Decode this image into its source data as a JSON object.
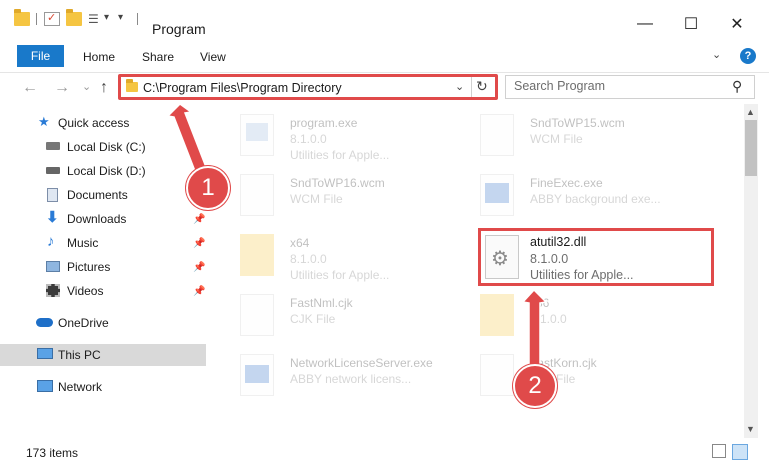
{
  "window": {
    "title": "Program",
    "minimize": "—",
    "maximize": "☐",
    "close": "✕"
  },
  "ribbon": {
    "tabs": [
      "File",
      "Home",
      "Share",
      "View"
    ],
    "help": "?"
  },
  "nav": {
    "back": "←",
    "forward": "→",
    "recent": "⌄",
    "up": "↑",
    "address": "C:\\Program Files\\Program Directory",
    "search_placeholder": "Search Program"
  },
  "sidebar": {
    "items": [
      {
        "label": "Quick access",
        "icon": "star-icon"
      },
      {
        "label": "Local Disk (C:)",
        "icon": "drive-icon"
      },
      {
        "label": "Local Disk (D:)",
        "icon": "drive-icon"
      },
      {
        "label": "Documents",
        "icon": "documents-icon"
      },
      {
        "label": "Downloads",
        "icon": "download-icon"
      },
      {
        "label": "Music",
        "icon": "music-icon"
      },
      {
        "label": "Pictures",
        "icon": "pictures-icon"
      },
      {
        "label": "Videos",
        "icon": "videos-icon"
      },
      {
        "label": "OneDrive",
        "icon": "cloud-icon"
      },
      {
        "label": "This PC",
        "icon": "computer-icon"
      },
      {
        "label": "Network",
        "icon": "network-icon"
      }
    ]
  },
  "files": [
    {
      "name": "program.exe",
      "line2": "8.1.0.0",
      "line3": "Utilities for Apple..."
    },
    {
      "name": "SndToWP15.wcm",
      "line2": "WCM File",
      "line3": ""
    },
    {
      "name": "SndToWP16.wcm",
      "line2": "WCM File",
      "line3": ""
    },
    {
      "name": "FineExec.exe",
      "line2": "ABBY background exe...",
      "line3": ""
    },
    {
      "name": "x64",
      "line2": "8.1.0.0",
      "line3": "Utilities for Apple..."
    },
    {
      "name": "atutil32.dll",
      "line2": "8.1.0.0",
      "line3": "Utilities for Apple..."
    },
    {
      "name": "FastNml.cjk",
      "line2": "CJK File",
      "line3": ""
    },
    {
      "name": "x86",
      "line2": "8.1.0.0",
      "line3": ""
    },
    {
      "name": "NetworkLicenseServer.exe",
      "line2": "ABBY network licens...",
      "line3": ""
    },
    {
      "name": "FastKorn.cjk",
      "line2": "CJK File",
      "line3": ""
    }
  ],
  "status": {
    "items": "173 items"
  },
  "callouts": {
    "one": "1",
    "two": "2"
  },
  "colors": {
    "accent": "#1979ca",
    "highlight": "#e04a4a"
  }
}
